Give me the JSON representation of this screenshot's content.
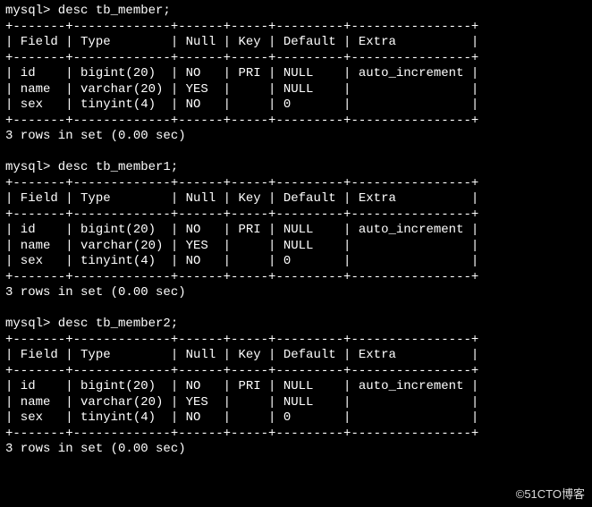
{
  "prompt": "mysql>",
  "summary_tpl": " rows in set (",
  "summary_end": ")",
  "sections": [
    {
      "command": "desc tb_member;",
      "rows_count": "3",
      "time": "0.00 sec",
      "headers": {
        "field": "Field",
        "type": "Type",
        "null": "Null",
        "key": "Key",
        "default": "Default",
        "extra": "Extra"
      },
      "rows": [
        {
          "field": "id",
          "type": "bigint(20)",
          "null": "NO",
          "key": "PRI",
          "default": "NULL",
          "extra": "auto_increment"
        },
        {
          "field": "name",
          "type": "varchar(20)",
          "null": "YES",
          "key": "",
          "default": "NULL",
          "extra": ""
        },
        {
          "field": "sex",
          "type": "tinyint(4)",
          "null": "NO",
          "key": "",
          "default": "0",
          "extra": ""
        }
      ]
    },
    {
      "command": "desc tb_member1;",
      "rows_count": "3",
      "time": "0.00 sec",
      "headers": {
        "field": "Field",
        "type": "Type",
        "null": "Null",
        "key": "Key",
        "default": "Default",
        "extra": "Extra"
      },
      "rows": [
        {
          "field": "id",
          "type": "bigint(20)",
          "null": "NO",
          "key": "PRI",
          "default": "NULL",
          "extra": "auto_increment"
        },
        {
          "field": "name",
          "type": "varchar(20)",
          "null": "YES",
          "key": "",
          "default": "NULL",
          "extra": ""
        },
        {
          "field": "sex",
          "type": "tinyint(4)",
          "null": "NO",
          "key": "",
          "default": "0",
          "extra": ""
        }
      ]
    },
    {
      "command": "desc tb_member2;",
      "rows_count": "3",
      "time": "0.00 sec",
      "headers": {
        "field": "Field",
        "type": "Type",
        "null": "Null",
        "key": "Key",
        "default": "Default",
        "extra": "Extra"
      },
      "rows": [
        {
          "field": "id",
          "type": "bigint(20)",
          "null": "NO",
          "key": "PRI",
          "default": "NULL",
          "extra": "auto_increment"
        },
        {
          "field": "name",
          "type": "varchar(20)",
          "null": "YES",
          "key": "",
          "default": "NULL",
          "extra": ""
        },
        {
          "field": "sex",
          "type": "tinyint(4)",
          "null": "NO",
          "key": "",
          "default": "0",
          "extra": ""
        }
      ]
    }
  ],
  "watermark": "©51CTO博客",
  "chart_data": {
    "type": "table",
    "title": "MySQL DESCRIBE output for tb_member, tb_member1, tb_member2 (identical schema)",
    "columns": [
      "Field",
      "Type",
      "Null",
      "Key",
      "Default",
      "Extra"
    ],
    "rows": [
      [
        "id",
        "bigint(20)",
        "NO",
        "PRI",
        "NULL",
        "auto_increment"
      ],
      [
        "name",
        "varchar(20)",
        "YES",
        "",
        "NULL",
        ""
      ],
      [
        "sex",
        "tinyint(4)",
        "NO",
        "",
        "0",
        ""
      ]
    ]
  }
}
